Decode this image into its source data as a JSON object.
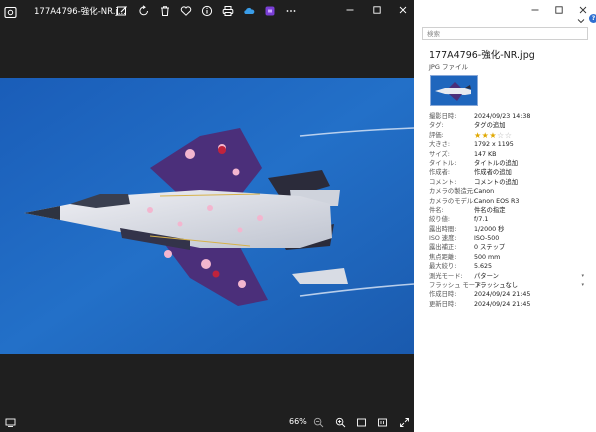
{
  "viewer": {
    "title": "177A4796-強化-NR.j...",
    "zoom": "66%",
    "toolbar_icons": [
      "edit-icon",
      "rotate-icon",
      "delete-icon",
      "favorite-icon",
      "info-icon",
      "print-icon",
      "onedrive-icon",
      "clipchamp-icon",
      "more-icon"
    ],
    "window_icons": [
      "minimize-icon",
      "maximize-icon",
      "close-icon"
    ]
  },
  "properties": {
    "search_placeholder": "検索",
    "file_name": "177A4796-強化-NR.jpg",
    "file_type": "JPG ファイル",
    "rating": 3,
    "rating_max": 5,
    "rows": [
      {
        "key": "撮影日時:",
        "value": "2024/09/23 14:38"
      },
      {
        "key": "タグ:",
        "value": "タグの追加"
      },
      {
        "key": "評価:",
        "value": ""
      },
      {
        "key": "大きさ:",
        "value": "1792 x 1195"
      },
      {
        "key": "サイズ:",
        "value": "147 KB"
      },
      {
        "key": "タイトル:",
        "value": "タイトルの追加"
      },
      {
        "key": "作成者:",
        "value": "作成者の追加"
      },
      {
        "key": "コメント:",
        "value": "コメントの追加"
      },
      {
        "key": "カメラの製造元:",
        "value": "Canon"
      },
      {
        "key": "カメラのモデル:",
        "value": "Canon EOS R3"
      },
      {
        "key": "件名:",
        "value": "件名の指定"
      },
      {
        "key": "絞り値:",
        "value": "f/7.1"
      },
      {
        "key": "露出時間:",
        "value": "1/2000 秒"
      },
      {
        "key": "ISO 速度:",
        "value": "ISO-500"
      },
      {
        "key": "露出補正:",
        "value": "0 ステップ"
      },
      {
        "key": "焦点距離:",
        "value": "500 mm"
      },
      {
        "key": "最大絞り:",
        "value": "5.625"
      },
      {
        "key": "測光モード:",
        "value": "パターン"
      },
      {
        "key": "フラッシュ モード:",
        "value": "フラッシュなし"
      },
      {
        "key": "作成日時:",
        "value": "2024/09/24 21:45"
      },
      {
        "key": "更新日時:",
        "value": "2024/09/24 21:45"
      }
    ]
  },
  "colors": {
    "viewer_bg": "#1f1f1f",
    "sky_blue": "#1f66bd",
    "accent": "#2f6fd1",
    "star": "#e0a800"
  }
}
